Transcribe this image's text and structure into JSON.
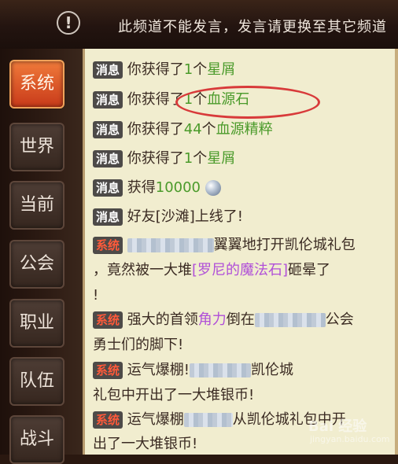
{
  "banner": {
    "warning_icon": "exclamation-circle-icon",
    "message": "此频道不能发言，发言请更换至其它频道"
  },
  "tabs": [
    {
      "label": "系统",
      "active": true
    },
    {
      "label": "世界"
    },
    {
      "label": "当前"
    },
    {
      "label": "公会"
    },
    {
      "label": "职业"
    },
    {
      "label": "队伍"
    },
    {
      "label": "战斗"
    }
  ],
  "tags": {
    "info": "消息",
    "system": "系统"
  },
  "messages": {
    "m1": {
      "pre": "你获得了",
      "qty": "1",
      "unit": "个",
      "item": "星屑"
    },
    "m2": {
      "pre": "你获得了",
      "qty": "1",
      "unit": "个",
      "item": "血源石"
    },
    "m3": {
      "pre": "你获得了",
      "qty": "44",
      "unit": "个",
      "item": "血源精粹"
    },
    "m4": {
      "pre": "你获得了",
      "qty": "1",
      "unit": "个",
      "item": "星屑"
    },
    "m5": {
      "pre": "获得",
      "qty": "10000",
      "icon": "silver-coin-icon"
    },
    "m6": {
      "text": "好友[沙滩]上线了!"
    },
    "s1": {
      "l1": "翼翼地打开凯伦城礼包",
      "l2a": "，竟然被一大堆",
      "l2b": "[罗尼的魔法石]",
      "l2c": "砸晕了",
      "l3": "!"
    },
    "s2": {
      "l1a": "强大的首领",
      "l1b": "角力",
      "l1c": "倒在",
      "l1d": "公会",
      "l2": "勇士们的脚下!"
    },
    "s3": {
      "l1a": "运气爆棚!",
      "l1b": "凯伦城",
      "l2": "礼包中开出了一大堆银币!"
    },
    "s4": {
      "l1a": "运气爆棚",
      "l1b": "从凯伦城礼包中开",
      "l2": "出了一大堆银币!"
    }
  },
  "colors": {
    "accent": "#d83a3a",
    "green": "#4a9a2a",
    "purple": "#b04fd8",
    "panel": "#f1edcf"
  },
  "watermark": {
    "main": "Bai 经验",
    "sub": "jingyan.baidu.com"
  }
}
